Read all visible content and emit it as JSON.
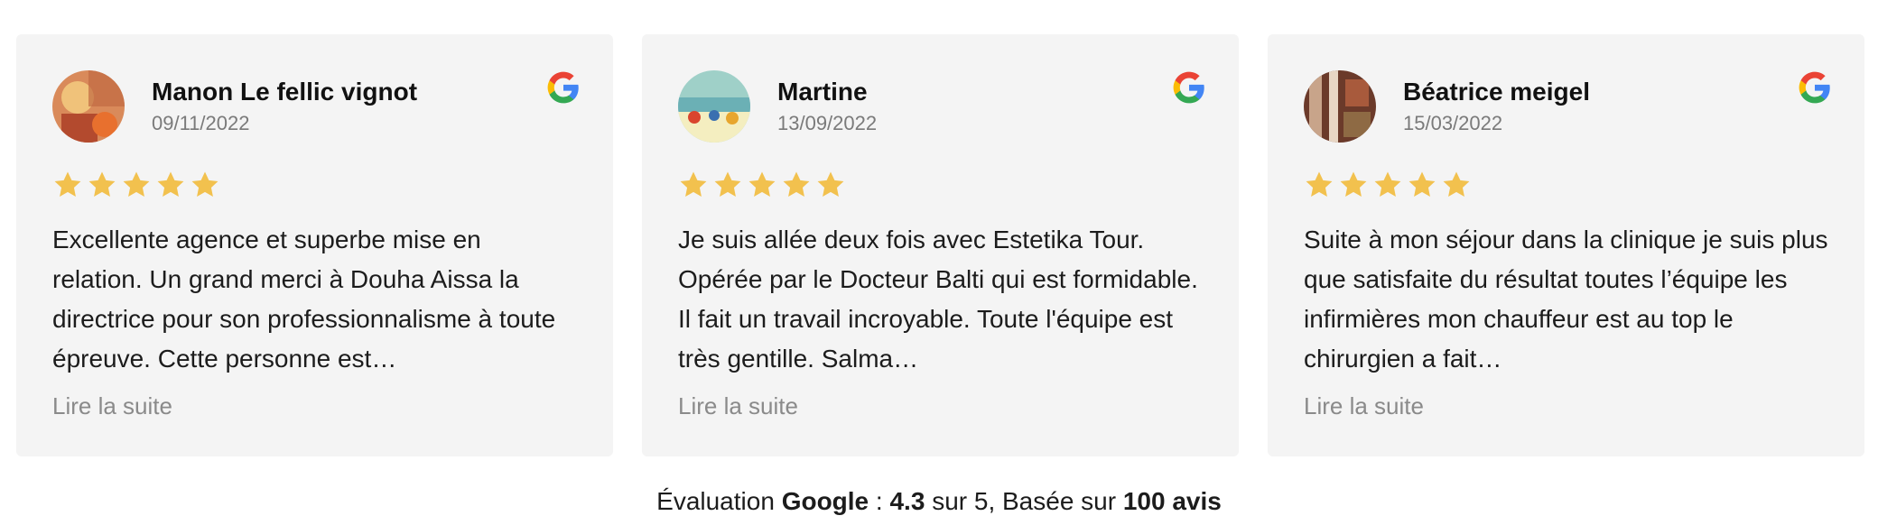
{
  "reviews": [
    {
      "name": "Manon Le fellic vignot",
      "date": "09/11/2022",
      "rating": 5,
      "text": "Excellente agence et superbe mise en relation. Un grand merci à Douha Aissa la directrice pour son professionnalisme à toute épreuve. Cette personne est…",
      "more": "Lire la suite",
      "avatar_icon": "avatar-photo-icon"
    },
    {
      "name": "Martine",
      "date": "13/09/2022",
      "rating": 5,
      "text": "Je suis allée deux fois avec Estetika Tour. Opérée par le Docteur Balti qui est formidable. Il fait un travail incroyable. Toute l'équipe est très gentille. Salma…",
      "more": "Lire la suite",
      "avatar_icon": "avatar-photo-icon"
    },
    {
      "name": "Béatrice meigel",
      "date": "15/03/2022",
      "rating": 5,
      "text": "Suite à mon séjour dans la clinique je suis plus que satisfaite du résultat toutes l’équipe les infirmières mon chauffeur est au top le chirurgien a fait…",
      "more": "Lire la suite",
      "avatar_icon": "avatar-photo-icon"
    }
  ],
  "summary": {
    "prefix": "Évaluation ",
    "brand": "Google",
    "sep": " : ",
    "score": "4.3",
    "mid": " sur 5, Basée sur ",
    "count": "100 avis"
  },
  "colors": {
    "card_bg": "#f4f4f4",
    "star": "#f2c14e",
    "muted": "#7a7a7a"
  }
}
